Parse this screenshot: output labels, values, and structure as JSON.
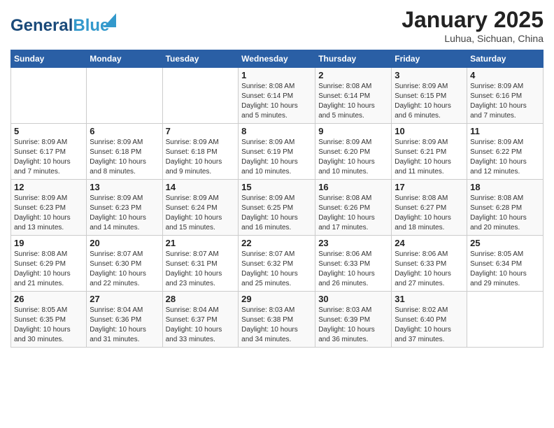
{
  "header": {
    "logo_general": "General",
    "logo_blue": "Blue",
    "month_title": "January 2025",
    "location": "Luhua, Sichuan, China"
  },
  "days_of_week": [
    "Sunday",
    "Monday",
    "Tuesday",
    "Wednesday",
    "Thursday",
    "Friday",
    "Saturday"
  ],
  "weeks": [
    [
      {
        "day": "",
        "info": ""
      },
      {
        "day": "",
        "info": ""
      },
      {
        "day": "",
        "info": ""
      },
      {
        "day": "1",
        "info": "Sunrise: 8:08 AM\nSunset: 6:14 PM\nDaylight: 10 hours\nand 5 minutes."
      },
      {
        "day": "2",
        "info": "Sunrise: 8:08 AM\nSunset: 6:14 PM\nDaylight: 10 hours\nand 5 minutes."
      },
      {
        "day": "3",
        "info": "Sunrise: 8:09 AM\nSunset: 6:15 PM\nDaylight: 10 hours\nand 6 minutes."
      },
      {
        "day": "4",
        "info": "Sunrise: 8:09 AM\nSunset: 6:16 PM\nDaylight: 10 hours\nand 7 minutes."
      }
    ],
    [
      {
        "day": "5",
        "info": "Sunrise: 8:09 AM\nSunset: 6:17 PM\nDaylight: 10 hours\nand 7 minutes."
      },
      {
        "day": "6",
        "info": "Sunrise: 8:09 AM\nSunset: 6:18 PM\nDaylight: 10 hours\nand 8 minutes."
      },
      {
        "day": "7",
        "info": "Sunrise: 8:09 AM\nSunset: 6:18 PM\nDaylight: 10 hours\nand 9 minutes."
      },
      {
        "day": "8",
        "info": "Sunrise: 8:09 AM\nSunset: 6:19 PM\nDaylight: 10 hours\nand 10 minutes."
      },
      {
        "day": "9",
        "info": "Sunrise: 8:09 AM\nSunset: 6:20 PM\nDaylight: 10 hours\nand 10 minutes."
      },
      {
        "day": "10",
        "info": "Sunrise: 8:09 AM\nSunset: 6:21 PM\nDaylight: 10 hours\nand 11 minutes."
      },
      {
        "day": "11",
        "info": "Sunrise: 8:09 AM\nSunset: 6:22 PM\nDaylight: 10 hours\nand 12 minutes."
      }
    ],
    [
      {
        "day": "12",
        "info": "Sunrise: 8:09 AM\nSunset: 6:23 PM\nDaylight: 10 hours\nand 13 minutes."
      },
      {
        "day": "13",
        "info": "Sunrise: 8:09 AM\nSunset: 6:23 PM\nDaylight: 10 hours\nand 14 minutes."
      },
      {
        "day": "14",
        "info": "Sunrise: 8:09 AM\nSunset: 6:24 PM\nDaylight: 10 hours\nand 15 minutes."
      },
      {
        "day": "15",
        "info": "Sunrise: 8:09 AM\nSunset: 6:25 PM\nDaylight: 10 hours\nand 16 minutes."
      },
      {
        "day": "16",
        "info": "Sunrise: 8:08 AM\nSunset: 6:26 PM\nDaylight: 10 hours\nand 17 minutes."
      },
      {
        "day": "17",
        "info": "Sunrise: 8:08 AM\nSunset: 6:27 PM\nDaylight: 10 hours\nand 18 minutes."
      },
      {
        "day": "18",
        "info": "Sunrise: 8:08 AM\nSunset: 6:28 PM\nDaylight: 10 hours\nand 20 minutes."
      }
    ],
    [
      {
        "day": "19",
        "info": "Sunrise: 8:08 AM\nSunset: 6:29 PM\nDaylight: 10 hours\nand 21 minutes."
      },
      {
        "day": "20",
        "info": "Sunrise: 8:07 AM\nSunset: 6:30 PM\nDaylight: 10 hours\nand 22 minutes."
      },
      {
        "day": "21",
        "info": "Sunrise: 8:07 AM\nSunset: 6:31 PM\nDaylight: 10 hours\nand 23 minutes."
      },
      {
        "day": "22",
        "info": "Sunrise: 8:07 AM\nSunset: 6:32 PM\nDaylight: 10 hours\nand 25 minutes."
      },
      {
        "day": "23",
        "info": "Sunrise: 8:06 AM\nSunset: 6:33 PM\nDaylight: 10 hours\nand 26 minutes."
      },
      {
        "day": "24",
        "info": "Sunrise: 8:06 AM\nSunset: 6:33 PM\nDaylight: 10 hours\nand 27 minutes."
      },
      {
        "day": "25",
        "info": "Sunrise: 8:05 AM\nSunset: 6:34 PM\nDaylight: 10 hours\nand 29 minutes."
      }
    ],
    [
      {
        "day": "26",
        "info": "Sunrise: 8:05 AM\nSunset: 6:35 PM\nDaylight: 10 hours\nand 30 minutes."
      },
      {
        "day": "27",
        "info": "Sunrise: 8:04 AM\nSunset: 6:36 PM\nDaylight: 10 hours\nand 31 minutes."
      },
      {
        "day": "28",
        "info": "Sunrise: 8:04 AM\nSunset: 6:37 PM\nDaylight: 10 hours\nand 33 minutes."
      },
      {
        "day": "29",
        "info": "Sunrise: 8:03 AM\nSunset: 6:38 PM\nDaylight: 10 hours\nand 34 minutes."
      },
      {
        "day": "30",
        "info": "Sunrise: 8:03 AM\nSunset: 6:39 PM\nDaylight: 10 hours\nand 36 minutes."
      },
      {
        "day": "31",
        "info": "Sunrise: 8:02 AM\nSunset: 6:40 PM\nDaylight: 10 hours\nand 37 minutes."
      },
      {
        "day": "",
        "info": ""
      }
    ]
  ]
}
